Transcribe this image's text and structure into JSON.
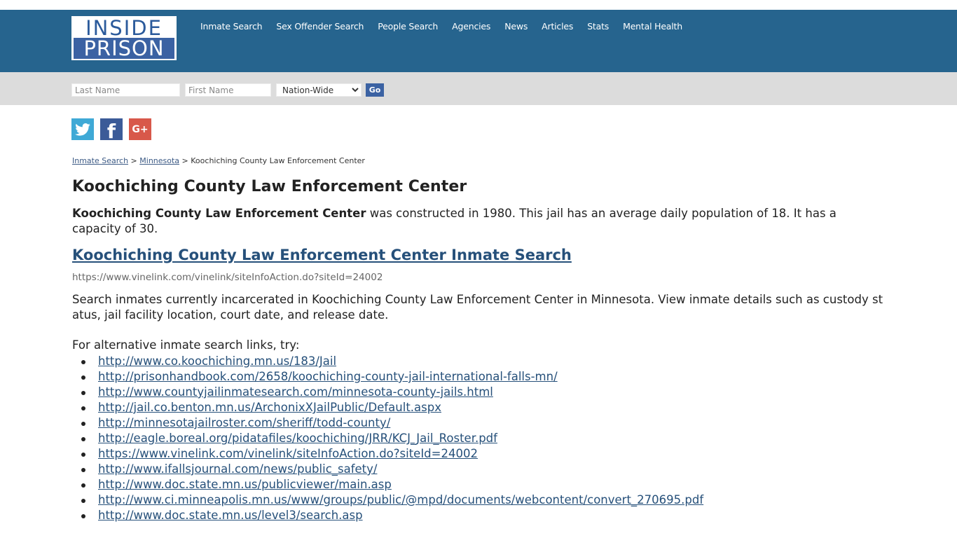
{
  "header": {
    "logo": {
      "top": "INSIDE",
      "bottom": "PRISON"
    },
    "nav": [
      "Inmate Search",
      "Sex Offender Search",
      "People Search",
      "Agencies",
      "News",
      "Articles",
      "Stats",
      "Mental Health"
    ]
  },
  "search": {
    "last_name_placeholder": "Last Name",
    "first_name_placeholder": "First Name",
    "state_selected": "Nation-Wide",
    "go_label": "Go"
  },
  "social": {
    "twitter": "twitter-icon",
    "facebook": "facebook-icon",
    "google_plus": "google-plus-icon",
    "facebook_glyph": "f",
    "google_glyph": "G+"
  },
  "breadcrumb": {
    "items": [
      "Inmate Search",
      "Minnesota"
    ],
    "separator": ">",
    "current": "Koochiching County Law Enforcement Center"
  },
  "page": {
    "title": "Koochiching County Law Enforcement Center",
    "intro_bold": "Koochiching County Law Enforcement Center",
    "intro_rest": " was constructed in 1980. This jail has an average daily population of 18. It has a capacity of 30.",
    "search_link": "Koochiching County Law Enforcement Center Inmate Search",
    "search_url": "https://www.vinelink.com/vinelink/siteInfoAction.do?siteId=24002",
    "description": "Search inmates currently incarcerated in Koochiching County Law Enforcement Center in Minnesota. View inmate details such as custody status, jail facility location, court date, and release date.",
    "alt_intro": "For alternative inmate search links, try:",
    "alt_links": [
      "http://www.co.koochiching.mn.us/183/Jail",
      "http://prisonhandbook.com/2658/koochiching-county-jail-international-falls-mn/",
      "http://www.countyjailinmatesearch.com/minnesota-county-jails.html",
      "http://jail.co.benton.mn.us/ArchonixXJailPublic/Default.aspx",
      "http://minnesotajailroster.com/sheriff/todd-county/",
      "http://eagle.boreal.org/pidatafiles/koochiching/JRR/KCJ_Jail_Roster.pdf",
      "https://www.vinelink.com/vinelink/siteInfoAction.do?siteId=24002",
      "http://www.ifallsjournal.com/news/public_safety/",
      "http://www.doc.state.mn.us/publicviewer/main.asp",
      "http://www.ci.minneapolis.mn.us/www/groups/public/@mpd/documents/webcontent/convert_270695.pdf",
      "http://www.doc.state.mn.us/level3/search.asp"
    ]
  }
}
